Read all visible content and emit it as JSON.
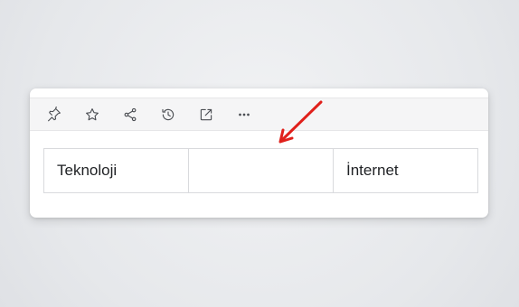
{
  "toolbar": {
    "icons": [
      "pin-icon",
      "star-icon",
      "share-icon",
      "history-icon",
      "open-external-icon",
      "more-icon"
    ]
  },
  "table": {
    "cells": [
      "Teknoloji",
      "",
      "İnternet"
    ]
  },
  "colors": {
    "annotation_arrow": "#e0201b",
    "toolbar_bg": "#f5f5f6",
    "icon": "#4a4d52"
  }
}
